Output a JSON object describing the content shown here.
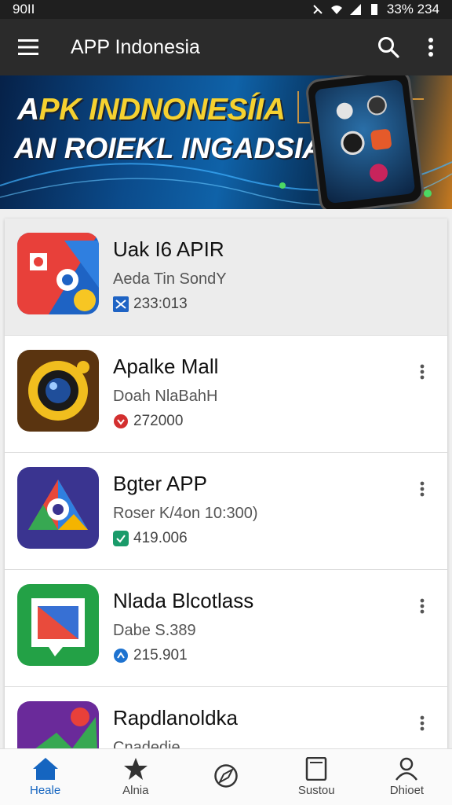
{
  "status_bar": {
    "time": "90II",
    "battery": "33% 234"
  },
  "app_bar": {
    "title": "APP Indonesia"
  },
  "banner": {
    "line1_a": "A",
    "line1_b": "PK INDNONESÍIA",
    "line2": "AN ROIEKL INGADSIA"
  },
  "apps": [
    {
      "name": "Uak I6 APIR",
      "subtitle": "Aeda Tin SondY",
      "meta": "233:013",
      "featured": true
    },
    {
      "name": "Apalke Mall",
      "subtitle": "Doah NlaBahH",
      "meta": "272000",
      "featured": false
    },
    {
      "name": "Bgter APP",
      "subtitle": "Roser K/4on 10:300)",
      "meta": "419.006",
      "featured": false
    },
    {
      "name": "Nlada Blcotlass",
      "subtitle": "Dabe S.389",
      "meta": "215.901",
      "featured": false
    },
    {
      "name": "Rapdlanoldka",
      "subtitle": "Cnadedie",
      "meta": "",
      "featured": false
    }
  ],
  "bottom_nav": [
    {
      "label": "Heale",
      "icon": "home-icon"
    },
    {
      "label": "Alnia",
      "icon": "star-icon"
    },
    {
      "label": "",
      "icon": "compass-icon"
    },
    {
      "label": "Sustou",
      "icon": "tablet-icon"
    },
    {
      "label": "Dhioet",
      "icon": "person-icon"
    }
  ],
  "colors": {
    "accent": "#1565c0",
    "app_bar": "#2b2b2b",
    "banner_yellow": "#f5d130"
  }
}
